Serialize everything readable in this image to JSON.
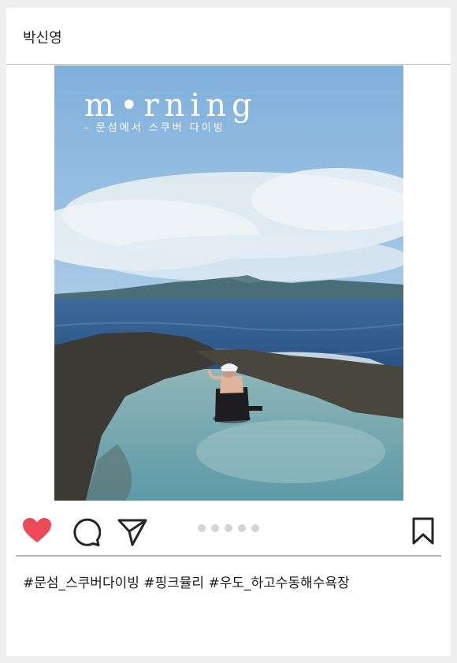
{
  "post": {
    "username": "박신영",
    "image": {
      "title": "m•rning",
      "subtitle": "- 문섬에서 스쿠버 다이빙"
    },
    "carousel": {
      "count": 5,
      "active": 0
    },
    "caption": "#문섬_스쿠버다이빙 #핑크뮬리 #우도_하고수동해수욕장",
    "icons": {
      "like": "heart-icon",
      "comment": "comment-icon",
      "share": "send-icon",
      "save": "bookmark-icon"
    },
    "colors": {
      "like": "#ed4956",
      "icon": "#262626"
    }
  }
}
